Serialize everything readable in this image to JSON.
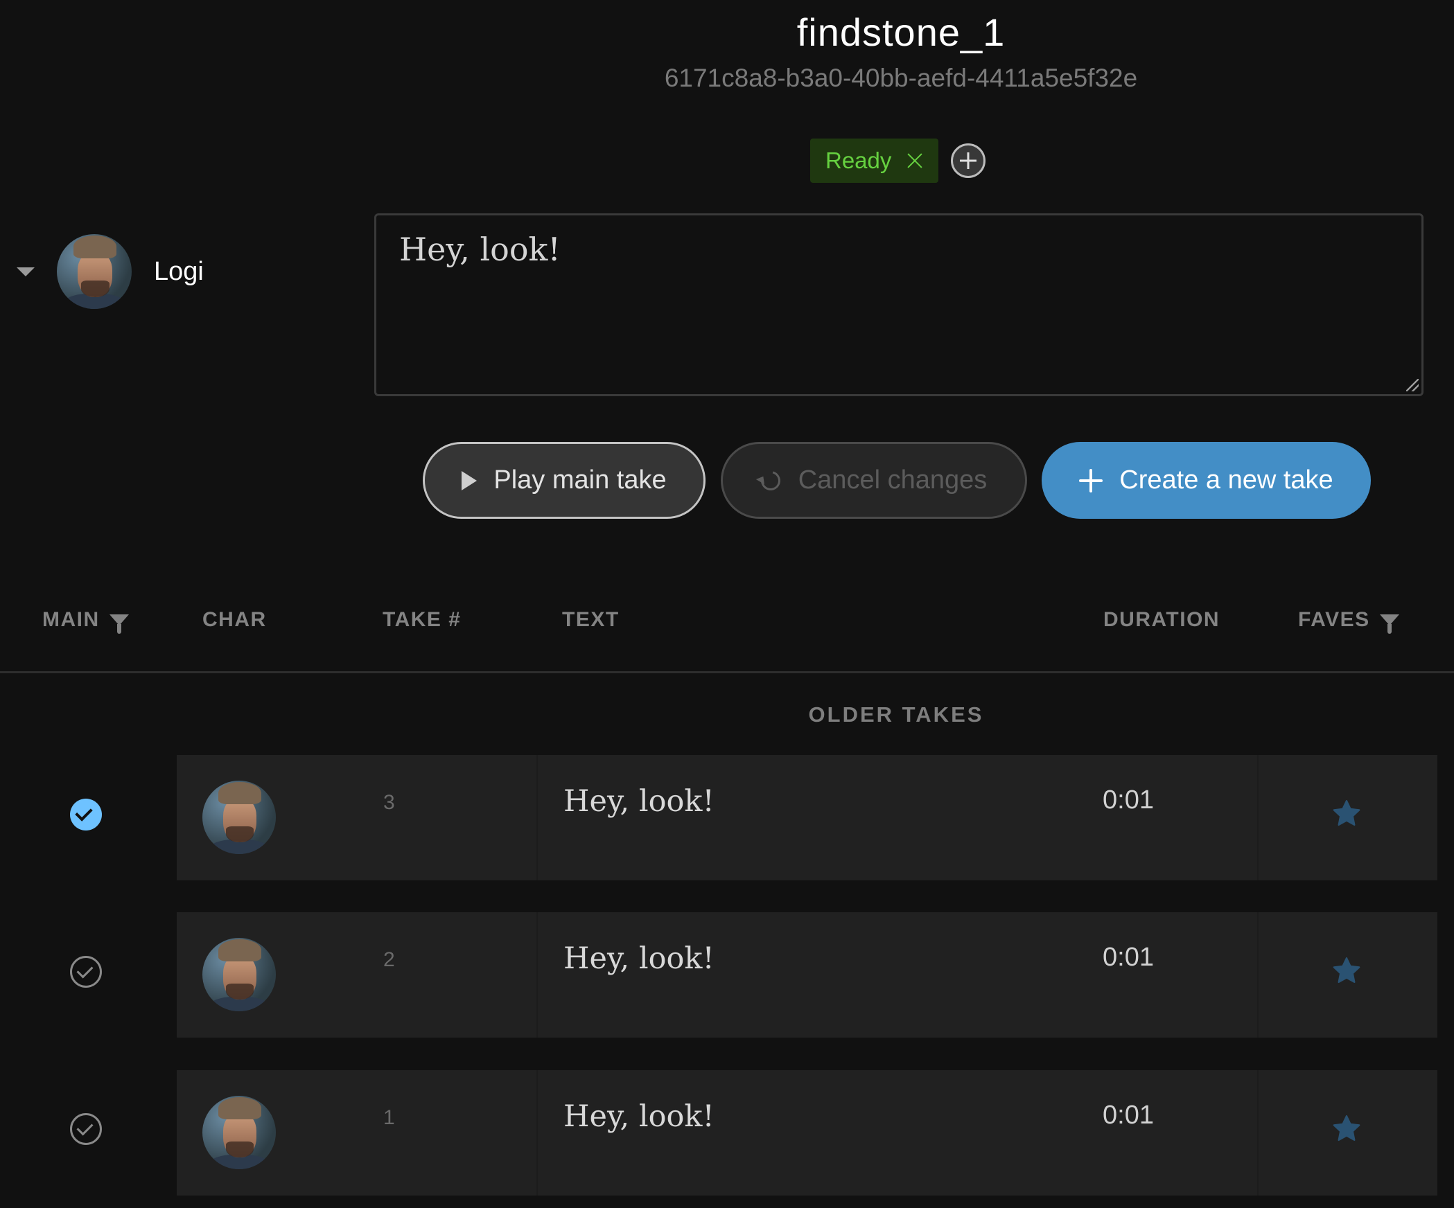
{
  "header": {
    "title": "findstone_1",
    "uuid": "6171c8a8-b3a0-40bb-aefd-4411a5e5f32e"
  },
  "tags": [
    {
      "label": "Ready",
      "color": "#66d140",
      "background": "#1f3810"
    }
  ],
  "add_tag_icon": "plus-circle-icon",
  "character": {
    "name": "Logi",
    "collapse_icon": "caret-down-icon"
  },
  "script": {
    "text": "Hey, look!"
  },
  "actions": {
    "play_label": "Play main take",
    "play_icon": "play-icon",
    "cancel_label": "Cancel changes",
    "cancel_icon": "undo-icon",
    "cancel_disabled": true,
    "create_label": "Create a new take",
    "create_icon": "plus-icon",
    "create_color": "#438ec6"
  },
  "table": {
    "columns": {
      "main": "MAIN",
      "char": "CHAR",
      "take": "TAKE #",
      "text": "TEXT",
      "duration": "DURATION",
      "faves": "FAVES"
    },
    "section_label": "OLDER TAKES",
    "rows": [
      {
        "main": true,
        "take": "3",
        "text": "Hey, look!",
        "duration": "0:01",
        "fave": true
      },
      {
        "main": false,
        "take": "2",
        "text": "Hey, look!",
        "duration": "0:01",
        "fave": true
      },
      {
        "main": false,
        "take": "1",
        "text": "Hey, look!",
        "duration": "0:01",
        "fave": true
      }
    ],
    "star_color": "#2a5272",
    "main_selected_color": "#6ec2ff"
  }
}
